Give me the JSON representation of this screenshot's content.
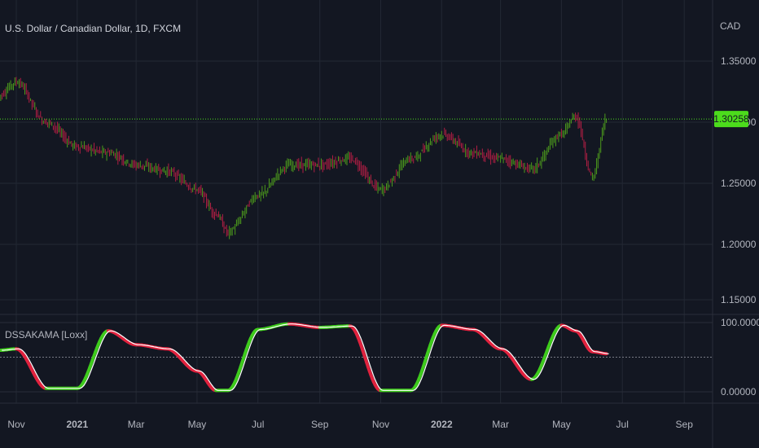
{
  "header": {
    "symbol_title": "U.S. Dollar / Canadian Dollar, 1D, FXCM",
    "currency": "CAD"
  },
  "price_axis": {
    "ticks": [
      "1.35000",
      "1.30000",
      "1.25000",
      "1.20000",
      "1.15000"
    ],
    "last_price": "1.30258",
    "last_price_bg": "#4cdc1c"
  },
  "indicator": {
    "name": "DSSAKAMA [Loxx]",
    "ticks": [
      "100.00000",
      "0.00000"
    ]
  },
  "time_axis": {
    "labels": [
      "Nov",
      "2021",
      "Mar",
      "May",
      "Jul",
      "Sep",
      "Nov",
      "2022",
      "Mar",
      "May",
      "Jul",
      "Sep"
    ]
  },
  "colors": {
    "background": "#131722",
    "up": "#4c9a1c",
    "down": "#b01e44",
    "signal_up": "#3ecb1c",
    "signal_down": "#e0223e",
    "signal_line": "#ffffff",
    "last_price_line": "#4cdc1c"
  },
  "chart_data": [
    {
      "type": "line",
      "title": "U.S. Dollar / Canadian Dollar, 1D, FXCM",
      "ylabel": "CAD",
      "ylim": [
        1.14,
        1.37
      ],
      "x": [
        "2020-10-15",
        "2020-11-01",
        "2020-12-01",
        "2021-01-01",
        "2021-02-01",
        "2021-03-01",
        "2021-04-01",
        "2021-05-01",
        "2021-05-20",
        "2021-06-01",
        "2021-07-01",
        "2021-08-01",
        "2021-09-01",
        "2021-10-01",
        "2021-11-01",
        "2021-12-01",
        "2022-01-01",
        "2022-02-01",
        "2022-03-01",
        "2022-04-01",
        "2022-05-01",
        "2022-05-15",
        "2022-06-01",
        "2022-06-15"
      ],
      "series": [
        {
          "values": [
            1.322,
            1.333,
            1.3,
            1.28,
            1.275,
            1.265,
            1.26,
            1.245,
            1.225,
            1.21,
            1.24,
            1.265,
            1.265,
            1.27,
            1.245,
            1.27,
            1.29,
            1.275,
            1.27,
            1.262,
            1.29,
            1.305,
            1.255,
            1.30258
          ]
        }
      ],
      "last_value": 1.30258
    },
    {
      "type": "line",
      "title": "DSSAKAMA [Loxx]",
      "ylim": [
        -5,
        105
      ],
      "x": [
        "2020-10-15",
        "2020-11-01",
        "2020-12-01",
        "2021-01-01",
        "2021-02-01",
        "2021-03-01",
        "2021-04-01",
        "2021-05-01",
        "2021-05-20",
        "2021-06-01",
        "2021-07-01",
        "2021-08-01",
        "2021-09-01",
        "2021-10-01",
        "2021-11-01",
        "2021-12-01",
        "2022-01-01",
        "2022-02-01",
        "2022-03-01",
        "2022-04-01",
        "2022-05-01",
        "2022-05-15",
        "2022-06-01",
        "2022-06-15"
      ],
      "series": [
        {
          "values": [
            60,
            62,
            5,
            5,
            88,
            68,
            62,
            30,
            2,
            2,
            90,
            98,
            93,
            95,
            2,
            2,
            96,
            90,
            62,
            18,
            96,
            88,
            58,
            55
          ]
        }
      ]
    }
  ]
}
